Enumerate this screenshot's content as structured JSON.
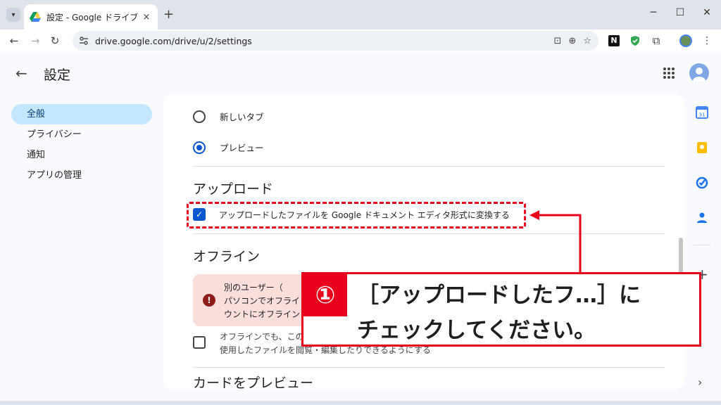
{
  "browser": {
    "tab_title": "設定 - Google ドライブ",
    "tab_close": "×",
    "new_tab": "+",
    "url": "drive.google.com/drive/u/2/settings",
    "minimize": "─",
    "maximize": "☐",
    "close": "✕",
    "ext_n": "N"
  },
  "header": {
    "title": "設定"
  },
  "sidebar": {
    "items": [
      {
        "label": "全般"
      },
      {
        "label": "プライバシー"
      },
      {
        "label": "通知"
      },
      {
        "label": "アプリの管理"
      }
    ]
  },
  "settings": {
    "radio_new_tab": "新しいタブ",
    "radio_preview": "プレビュー",
    "upload_title": "アップロード",
    "upload_convert_label": "アップロードしたファイルを Google ドキュメント エディタ形式に変換する",
    "offline_title": "オフライン",
    "warning_lines": [
      "別のユーザー（",
      "パソコンでオフライ",
      "ウントにオフライン"
    ],
    "offline_desc": "オフラインでも、このデバイスで Google ドキュメント、スプレッドシート、スライドのファイルを作成したり、最近使用したファイルを閲覧・編集したりできるようにする",
    "card_preview_title": "カードをプレビュー"
  },
  "callout": {
    "number": "①",
    "line1": "［アップロードしたフ…］に",
    "line2": "チェックしてください。"
  },
  "colors": {
    "accent_red": "#e8001c",
    "nav_active": "#c2e7ff",
    "checkbox_blue": "#0b57d0"
  }
}
